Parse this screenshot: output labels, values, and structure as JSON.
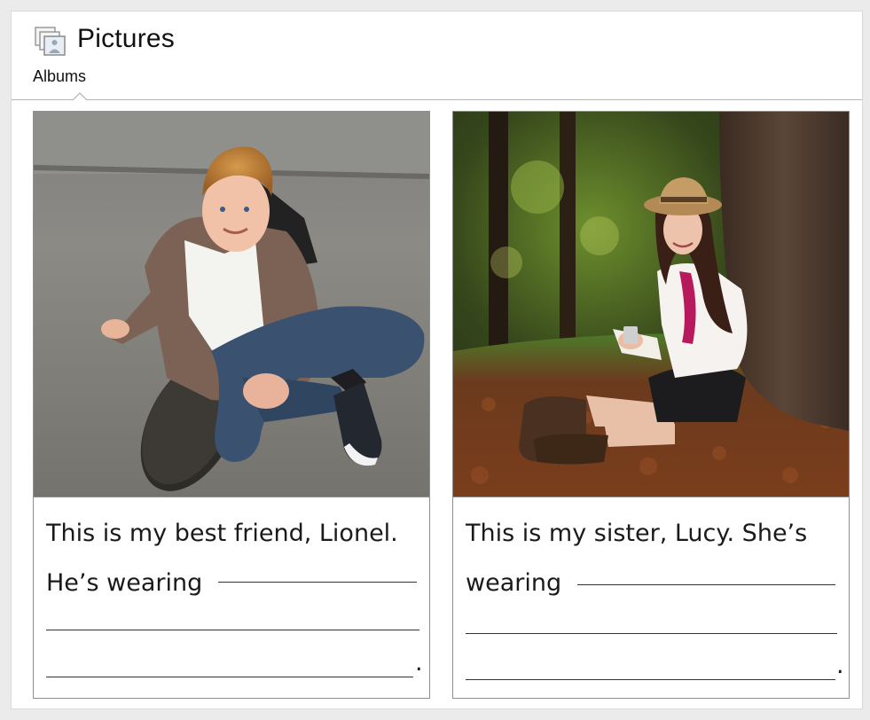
{
  "header": {
    "app_icon": "photo-gallery-icon",
    "title": "Pictures",
    "tab": "Albums"
  },
  "cards": [
    {
      "photo_description_icon": "boy-with-skateboard-photo",
      "line1": "This is my best friend, Lionel.",
      "line2": "He’s wearing",
      "end": "."
    },
    {
      "photo_description_icon": "girl-under-tree-photo",
      "line1": "This is my sister, Lucy. She’s",
      "line2": "wearing",
      "end": "."
    }
  ],
  "colors": {
    "background": "#ebebeb",
    "card_border": "#8f8f8f",
    "text": "#1a1a1a"
  }
}
